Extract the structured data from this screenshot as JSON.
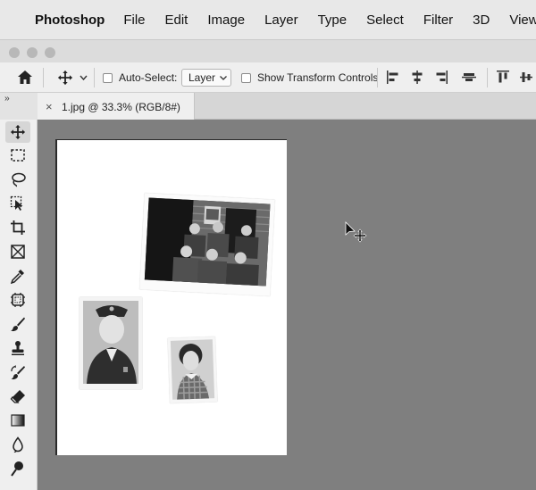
{
  "menubar": {
    "app_name": "Photoshop",
    "items": [
      "File",
      "Edit",
      "Image",
      "Layer",
      "Type",
      "Select",
      "Filter",
      "3D",
      "View"
    ]
  },
  "options_bar": {
    "auto_select_label": "Auto-Select:",
    "auto_select_checked": false,
    "auto_select_target": "Layer",
    "show_transform_label": "Show Transform Controls",
    "show_transform_checked": false
  },
  "document": {
    "tab_title": "1.jpg @ 33.3% (RGB/8#)",
    "close_glyph": "×"
  },
  "toolbar": {
    "collapse_glyph": "››",
    "tools": [
      "move-tool",
      "marquee-tool",
      "lasso-tool",
      "object-selection-tool",
      "crop-tool",
      "frame-tool",
      "eyedropper-tool",
      "spot-healing-tool",
      "brush-tool",
      "clone-stamp-tool",
      "history-brush-tool",
      "eraser-tool",
      "gradient-tool",
      "blur-tool",
      "dodge-tool"
    ]
  },
  "colors": {
    "menubar_bg": "#e8e8e8",
    "panel_bg": "#efefef",
    "canvas_bg": "#7f7f7f"
  }
}
